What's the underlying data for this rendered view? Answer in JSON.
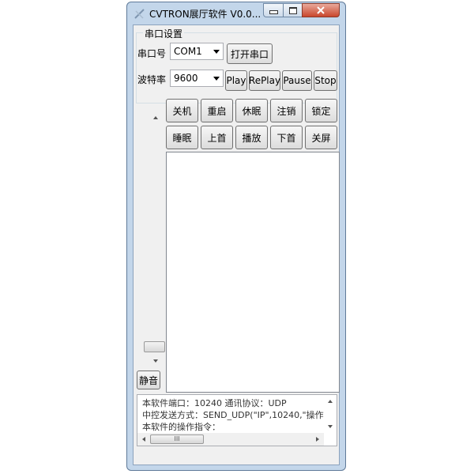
{
  "window": {
    "title": "CVTRON展厅软件 V0.0...",
    "icon": "app-logo-icon",
    "controls": [
      "minimize-icon",
      "maximize-icon",
      "close-icon"
    ]
  },
  "serial_group": {
    "title": "串口设置",
    "port_label": "串口号",
    "port_value": "COM1",
    "open_button": "打开串口",
    "baud_label": "波特率",
    "baud_value": "9600"
  },
  "media_buttons": [
    "Play",
    "RePlay",
    "Pause",
    "Stop"
  ],
  "command_rows": [
    [
      "关机",
      "重启",
      "休眠",
      "注销",
      "锁定"
    ],
    [
      "睡眠",
      "上首",
      "播放",
      "下首",
      "关屏"
    ]
  ],
  "mute_button": "静音",
  "info_lines": [
    "本软件端口：10240 通讯协议：UDP",
    "中控发送方式：SEND_UDP(\"IP\",10240,\"操作",
    "本软件的操作指令："
  ],
  "hscroll_thumb": "III",
  "colors": {
    "frame": "#c3d6ea",
    "close": "#c9462c",
    "face": "#f0f0f0"
  }
}
